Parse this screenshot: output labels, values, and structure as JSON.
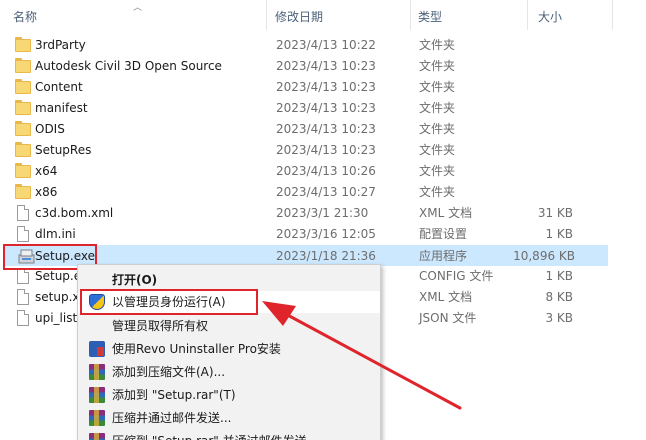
{
  "header": {
    "name": "名称",
    "date": "修改日期",
    "type": "类型",
    "size": "大小"
  },
  "files": [
    {
      "name": "3rdParty",
      "date": "2023/4/13 10:22",
      "type": "文件夹",
      "size": "",
      "icon": "folder-icon"
    },
    {
      "name": "Autodesk Civil 3D Open Source",
      "date": "2023/4/13 10:23",
      "type": "文件夹",
      "size": "",
      "icon": "folder-icon"
    },
    {
      "name": "Content",
      "date": "2023/4/13 10:23",
      "type": "文件夹",
      "size": "",
      "icon": "folder-icon"
    },
    {
      "name": "manifest",
      "date": "2023/4/13 10:23",
      "type": "文件夹",
      "size": "",
      "icon": "folder-icon"
    },
    {
      "name": "ODIS",
      "date": "2023/4/13 10:23",
      "type": "文件夹",
      "size": "",
      "icon": "folder-icon"
    },
    {
      "name": "SetupRes",
      "date": "2023/4/13 10:23",
      "type": "文件夹",
      "size": "",
      "icon": "folder-icon"
    },
    {
      "name": "x64",
      "date": "2023/4/13 10:26",
      "type": "文件夹",
      "size": "",
      "icon": "folder-icon"
    },
    {
      "name": "x86",
      "date": "2023/4/13 10:27",
      "type": "文件夹",
      "size": "",
      "icon": "folder-icon"
    },
    {
      "name": "c3d.bom.xml",
      "date": "2023/3/1 21:30",
      "type": "XML 文档",
      "size": "31 KB",
      "icon": "file-icon"
    },
    {
      "name": "dlm.ini",
      "date": "2023/3/16 12:05",
      "type": "配置设置",
      "size": "1 KB",
      "icon": "file-icon"
    },
    {
      "name": "Setup.exe",
      "date": "2023/1/18 21:36",
      "type": "应用程序",
      "size": "10,896 KB",
      "icon": "setup-exe-icon"
    },
    {
      "name": "Setup.e",
      "date": "",
      "type": "CONFIG 文件",
      "size": "1 KB",
      "icon": "file-icon"
    },
    {
      "name": "setup.x",
      "date": "",
      "type": "XML 文档",
      "size": "8 KB",
      "icon": "file-icon"
    },
    {
      "name": "upi_list.",
      "date": "",
      "type": "JSON 文件",
      "size": "3 KB",
      "icon": "file-icon"
    }
  ],
  "context_menu": {
    "items": [
      {
        "label": "打开(O)",
        "icon": ""
      },
      {
        "label": "以管理员身份运行(A)",
        "icon": "uac-shield-icon"
      },
      {
        "label": "管理员取得所有权",
        "icon": ""
      },
      {
        "label": "使用Revo Uninstaller Pro安装",
        "icon": "revo-uninstaller-icon"
      },
      {
        "label": "添加到压缩文件(A)...",
        "icon": "winrar-icon"
      },
      {
        "label": "添加到 \"Setup.rar\"(T)",
        "icon": "winrar-icon"
      },
      {
        "label": "压缩并通过邮件发送...",
        "icon": "winrar-icon"
      },
      {
        "label": "压缩到 \"Setup.rar\" 并通过邮件发送",
        "icon": "winrar-icon"
      }
    ]
  },
  "colors": {
    "selection": "#cce8ff",
    "annotation": "#e0242b",
    "folder": "#f8d775"
  }
}
